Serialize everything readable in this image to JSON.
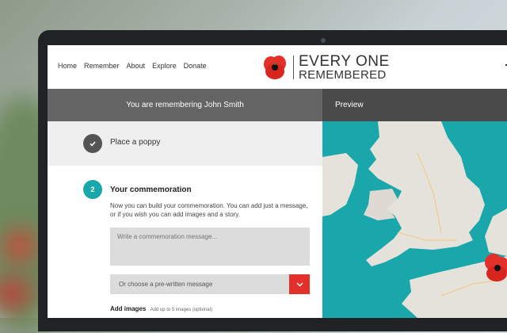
{
  "nav": {
    "items": [
      "Home",
      "Remember",
      "About",
      "Explore",
      "Donate"
    ]
  },
  "logo": {
    "line1": "EVERY ONE",
    "line2": "REMEMBERED"
  },
  "header": {
    "remembering": "You are remembering John Smith",
    "preview": "Preview"
  },
  "step1": {
    "label": "Place a poppy",
    "status": "complete"
  },
  "step2": {
    "number": "2",
    "title": "Your commemoration",
    "description": "Now you can build your commemoration. You can add just a message, or if you wish you can add images and a story.",
    "message_placeholder": "Write a commemoration message...",
    "select_label": "Or choose a pre-written message",
    "add_images_label": "Add images",
    "add_images_note": "Add up to 5 images (optional)"
  },
  "colors": {
    "accent_teal": "#18a8aa",
    "poppy_red": "#e4302a",
    "header_grey": "#646464",
    "preview_grey": "#4a4a4a"
  },
  "icons": [
    "poppy-logo-icon",
    "check-icon",
    "chevron-down-icon",
    "poppy-marker-icon"
  ]
}
